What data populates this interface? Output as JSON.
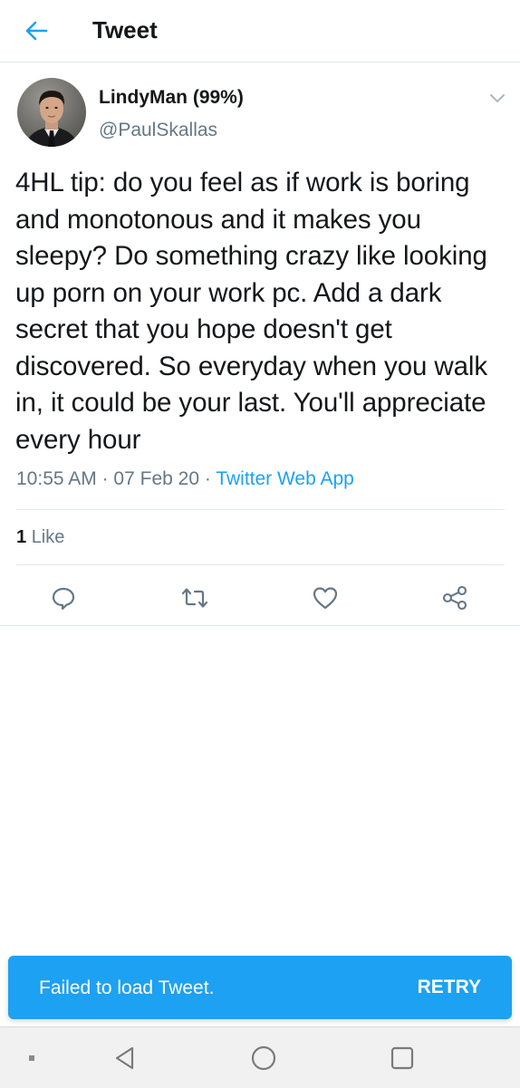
{
  "header": {
    "title": "Tweet",
    "back_icon": "arrow-left-icon"
  },
  "colors": {
    "accent": "#1da1f2",
    "text_primary": "#14171a",
    "text_secondary": "#657786",
    "divider": "#e1e8ed"
  },
  "tweet": {
    "author": {
      "display_name": "LindyMan (99%)",
      "handle": "@PaulSkallas"
    },
    "text": "4HL tip: do you feel as if work is boring and monotonous and it makes you sleepy? Do something crazy like looking up porn on your work pc. Add a dark secret that you hope doesn't get discovered. So everyday when you walk in, it could be your last. You'll appreciate every hour",
    "time": "10:55 AM",
    "date": "07 Feb 20",
    "separator": "·",
    "source": "Twitter Web App",
    "likes": {
      "count": "1",
      "label": "Like"
    }
  },
  "actions": [
    {
      "name": "reply",
      "icon": "reply-icon"
    },
    {
      "name": "retweet",
      "icon": "retweet-icon"
    },
    {
      "name": "like",
      "icon": "heart-icon"
    },
    {
      "name": "share",
      "icon": "share-icon"
    }
  ],
  "toast": {
    "message": "Failed to load Tweet.",
    "action": "RETRY"
  },
  "system_nav": {
    "items": [
      "menu-square-icon",
      "back-triangle-icon",
      "home-circle-icon",
      "recents-square-icon"
    ]
  }
}
